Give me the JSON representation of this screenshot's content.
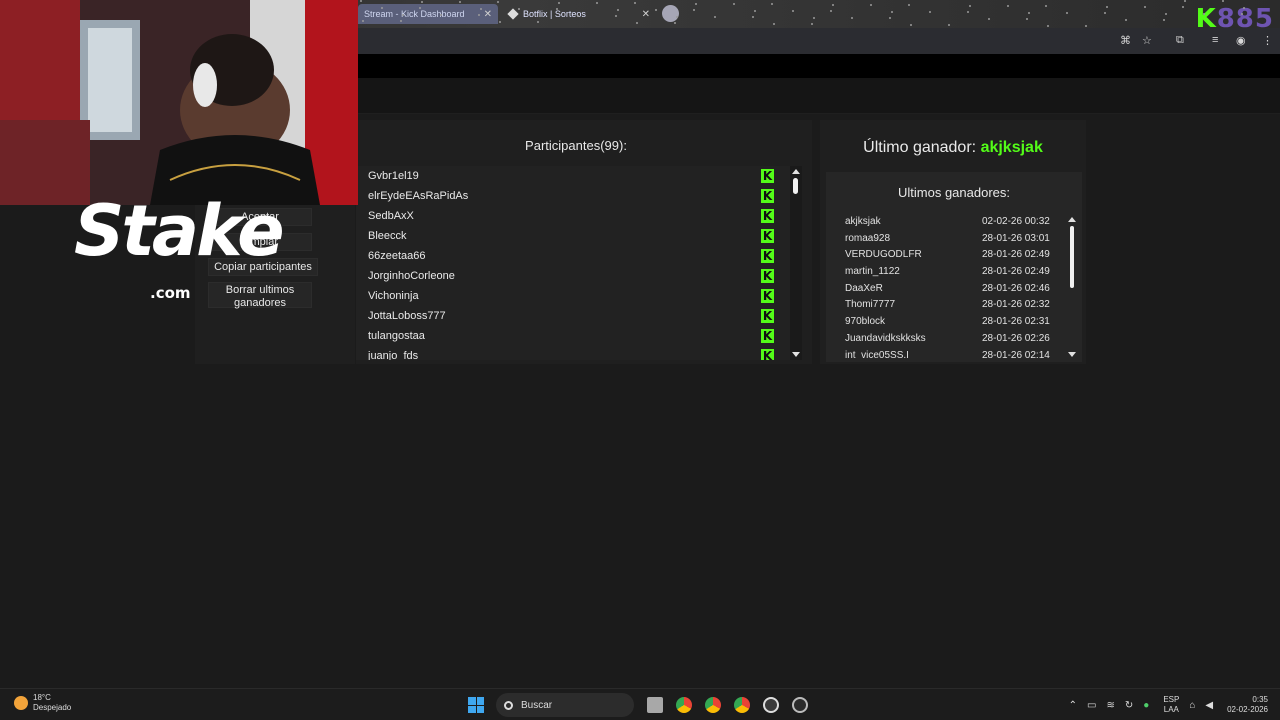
{
  "browser": {
    "tabs": [
      {
        "title": "Stream - Kick Dashboard"
      },
      {
        "title": "Botflix | Sorteos"
      }
    ],
    "kick_overlay_logo": {
      "letter": "K",
      "number": "885"
    }
  },
  "controls": {
    "aceptar": "Aceptar",
    "limpiar": "Limpiar",
    "participantes": "Copiar participantes",
    "ultimos": "Borrar ultimos ganadores"
  },
  "sponsor": {
    "brand": "Stake",
    "tld": ".com"
  },
  "participants": {
    "title": "Participantes(99):",
    "items": [
      {
        "name": "Gvbr1el19",
        "badge": "K"
      },
      {
        "name": "elrEydeEAsRaPidAs",
        "badge": "K"
      },
      {
        "name": "SedbAxX",
        "badge": "K"
      },
      {
        "name": "Bleecck",
        "badge": "K"
      },
      {
        "name": "66zeetaa66",
        "badge": "K"
      },
      {
        "name": "JorginhoCorleone",
        "badge": "K"
      },
      {
        "name": "Vichoninja",
        "badge": "K"
      },
      {
        "name": "JottaLoboss777",
        "badge": "K"
      },
      {
        "name": "tulangostaa",
        "badge": "K"
      },
      {
        "name": "juanjo_fds",
        "badge": "K"
      }
    ]
  },
  "winners": {
    "last_label": "Último ganador:",
    "last_name": "akjksjak",
    "list_title": "Ultimos ganadores:",
    "items": [
      {
        "name": "akjksjak",
        "date": "02-02-26 00:32"
      },
      {
        "name": "romaa928",
        "date": "28-01-26 03:01"
      },
      {
        "name": "VERDUGODLFR",
        "date": "28-01-26 02:49"
      },
      {
        "name": "martin_1122",
        "date": "28-01-26 02:49"
      },
      {
        "name": "DaaXeR",
        "date": "28-01-26 02:46"
      },
      {
        "name": "Thomi7777",
        "date": "28-01-26 02:32"
      },
      {
        "name": "970block",
        "date": "28-01-26 02:31"
      },
      {
        "name": "Juandavidkskksks",
        "date": "28-01-26 02:26"
      },
      {
        "name": "int_vice05SS.I",
        "date": "28-01-26 02:14"
      }
    ]
  },
  "taskbar": {
    "weather_temp": "18°C",
    "weather_desc": "Despejado",
    "search_placeholder": "Buscar",
    "lang_top": "ESP",
    "lang_bottom": "LAA",
    "time": "0:35",
    "date": "02-02-2026"
  },
  "colors": {
    "accent": "#53fc18",
    "panel": "#1f1f1f"
  }
}
